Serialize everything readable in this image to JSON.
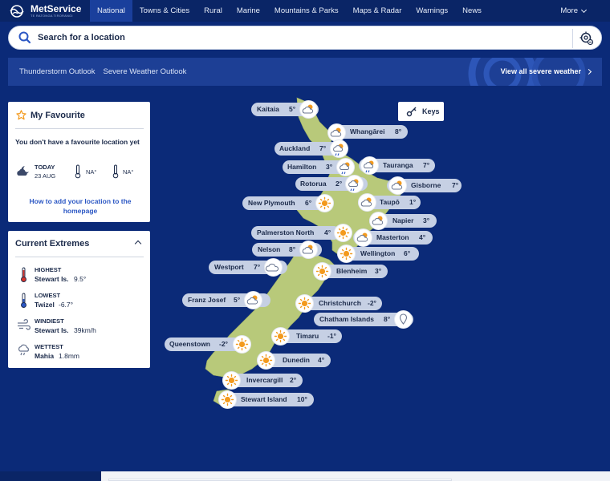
{
  "brand": {
    "name": "MetService",
    "sub": "TE RATONGA TIRORANGI"
  },
  "nav": {
    "items": [
      "National",
      "Towns & Cities",
      "Rural",
      "Marine",
      "Mountains & Parks",
      "Maps & Radar",
      "Warnings",
      "News"
    ],
    "more": "More"
  },
  "search": {
    "placeholder": "Search for a location"
  },
  "outlook": {
    "links": [
      "Thunderstorm Outlook",
      "Severe Weather Outlook"
    ],
    "view_all": "View all severe weather"
  },
  "keys_label": "Keys",
  "favourite": {
    "title": "My Favourite",
    "message": "You don't have a favourite location yet",
    "today_label": "TODAY",
    "date": "23 AUG",
    "max": "NA°",
    "min": "NA°",
    "link": "How to add your location to the homepage"
  },
  "extremes": {
    "title": "Current Extremes",
    "items": [
      {
        "label": "HIGHEST",
        "place": "Stewart Is.",
        "value": "9.5°",
        "icon": "thermometer-high-icon"
      },
      {
        "label": "LOWEST",
        "place": "Twizel",
        "value": "-6.7°",
        "icon": "thermometer-low-icon"
      },
      {
        "label": "WINDIEST",
        "place": "Stewart Is.",
        "value": "39km/h",
        "icon": "wind-icon"
      },
      {
        "label": "WETTEST",
        "place": "Mahia",
        "value": "1.8mm",
        "icon": "rain-icon"
      }
    ]
  },
  "locations": [
    {
      "name": "Kaitaia",
      "temp": "5°",
      "icon": "partly-cloudy"
    },
    {
      "name": "Whangārei",
      "temp": "8°",
      "icon": "partly-cloudy"
    },
    {
      "name": "Auckland",
      "temp": "7°",
      "icon": "showers"
    },
    {
      "name": "Hamilton",
      "temp": "3°",
      "icon": "showers"
    },
    {
      "name": "Tauranga",
      "temp": "7°",
      "icon": "showers"
    },
    {
      "name": "Rotorua",
      "temp": "2°",
      "icon": "showers"
    },
    {
      "name": "Gisborne",
      "temp": "7°",
      "icon": "partly-cloudy"
    },
    {
      "name": "New Plymouth",
      "temp": "6°",
      "icon": "sunny"
    },
    {
      "name": "Taupō",
      "temp": "1°",
      "icon": "partly-cloudy"
    },
    {
      "name": "Napier",
      "temp": "3°",
      "icon": "partly-cloudy"
    },
    {
      "name": "Palmerston North",
      "temp": "4°",
      "icon": "sunny"
    },
    {
      "name": "Masterton",
      "temp": "4°",
      "icon": "partly-cloudy"
    },
    {
      "name": "Nelson",
      "temp": "8°",
      "icon": "partly-cloudy"
    },
    {
      "name": "Wellington",
      "temp": "6°",
      "icon": "sunny"
    },
    {
      "name": "Westport",
      "temp": "7°",
      "icon": "cloudy"
    },
    {
      "name": "Blenheim",
      "temp": "3°",
      "icon": "sunny"
    },
    {
      "name": "Franz Josef",
      "temp": "5°",
      "icon": "partly-cloudy"
    },
    {
      "name": "Christchurch",
      "temp": "-2°",
      "icon": "sunny"
    },
    {
      "name": "Chatham Islands",
      "temp": "8°",
      "icon": "pin"
    },
    {
      "name": "Timaru",
      "temp": "-1°",
      "icon": "sunny"
    },
    {
      "name": "Queenstown",
      "temp": "-2°",
      "icon": "sunny"
    },
    {
      "name": "Dunedin",
      "temp": "4°",
      "icon": "sunny"
    },
    {
      "name": "Invercargill",
      "temp": "2°",
      "icon": "sunny"
    },
    {
      "name": "Stewart Island",
      "temp": "10°",
      "icon": "sunny"
    }
  ],
  "colors": {
    "nav_bg": "#0a2566",
    "map_bg": "#0b2a78",
    "land": "#b8c97a",
    "pill": "#c6d0e4",
    "sun": "#f39a1e"
  }
}
